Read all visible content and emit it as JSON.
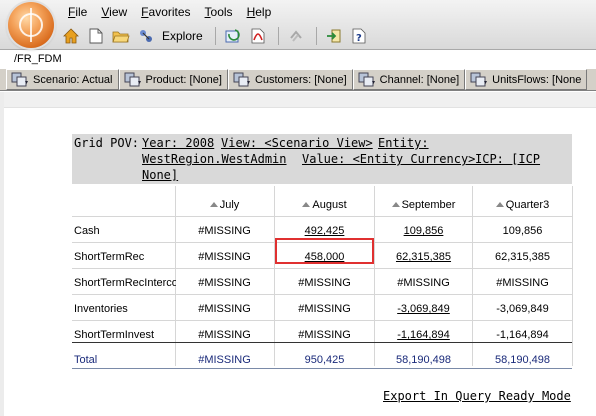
{
  "menu": [
    "File",
    "View",
    "Favorites",
    "Tools",
    "Help"
  ],
  "toolbar": {
    "explore_label": "Explore"
  },
  "path": "/FR_FDM",
  "dimensions": [
    "Scenario: Actual",
    "Product: [None]",
    "Customers: [None]",
    "Channel: [None]",
    "UnitsFlows: [None"
  ],
  "pov": {
    "label": "Grid POV:",
    "year": "Year: 2008",
    "view": "View: <Scenario View>",
    "entity_line1": "Entity:",
    "entity_line2": "WestRegion.WestAdmin",
    "value": "Value: <Entity Currency>",
    "icp_line1": "ICP: [ICP",
    "icp_line2": "None]"
  },
  "grid": {
    "columns": [
      "July",
      "August",
      "September",
      "Quarter3"
    ],
    "rows": [
      {
        "label": "Cash",
        "values": [
          "#MISSING",
          "492,425",
          "109,856",
          "109,856"
        ]
      },
      {
        "label": "ShortTermRec",
        "values": [
          "#MISSING",
          "458,000",
          "62,315,385",
          "62,315,385"
        ]
      },
      {
        "label": "ShortTermRecInterco",
        "values": [
          "#MISSING",
          "#MISSING",
          "#MISSING",
          "#MISSING"
        ]
      },
      {
        "label": "Inventories",
        "values": [
          "#MISSING",
          "#MISSING",
          "-3,069,849",
          "-3,069,849"
        ]
      },
      {
        "label": "ShortTermInvest",
        "values": [
          "#MISSING",
          "#MISSING",
          "-1,164,894",
          "-1,164,894"
        ]
      },
      {
        "label": "Total",
        "values": [
          "#MISSING",
          "950,425",
          "58,190,498",
          "58,190,498"
        ]
      }
    ]
  },
  "export_link": "Export In Query Ready Mode"
}
